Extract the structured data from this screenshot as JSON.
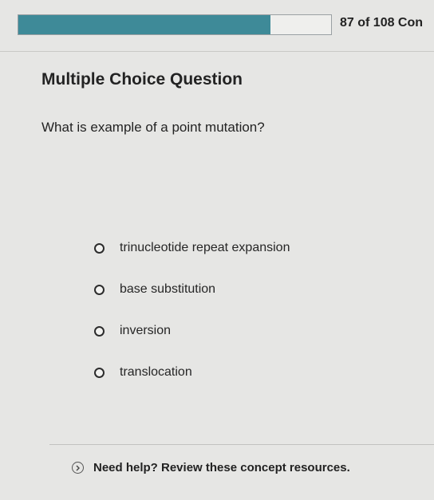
{
  "header": {
    "progress_text": "87 of 108 Con",
    "progress_fraction": 0.8055,
    "progress_color": "#3e8a98"
  },
  "question": {
    "section_title": "Multiple Choice Question",
    "prompt": "What is example of a point mutation?",
    "options": [
      {
        "label": "trinucleotide repeat expansion",
        "selected": false
      },
      {
        "label": "base substitution",
        "selected": false
      },
      {
        "label": "inversion",
        "selected": false
      },
      {
        "label": "translocation",
        "selected": false
      }
    ]
  },
  "help": {
    "label": "Need help? Review these concept resources.",
    "icon": "chevron-right-circle-icon"
  }
}
